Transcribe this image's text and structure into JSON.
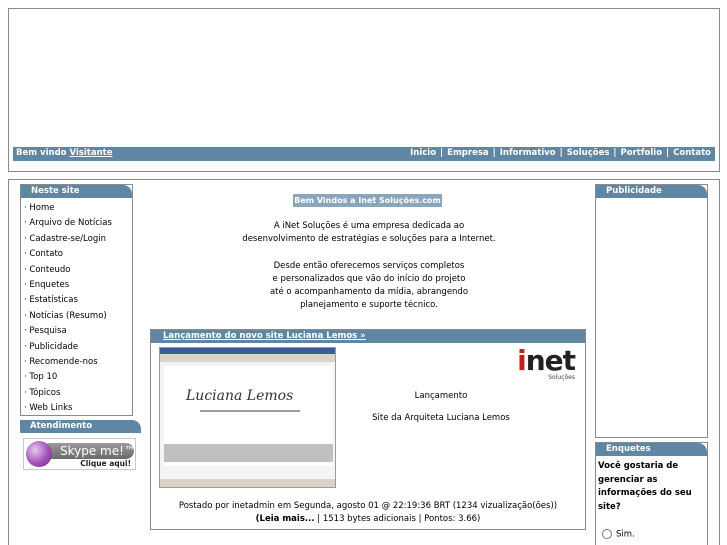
{
  "topbar": {
    "welcome_prefix": "Bem vindo",
    "welcome_user": "Visitante",
    "nav": [
      "Inicio",
      "Empresa",
      "Informativo",
      "Soluções",
      "Portfolio",
      "Contato"
    ]
  },
  "left_menu": {
    "title": "Neste site",
    "items": [
      "· Home",
      "· Arquivo de Notícias",
      "· Cadastre-se/Login",
      "· Contato",
      "· Conteudo",
      "· Enquetes",
      "· Estatísticas",
      "· Notícias (Resumo)",
      "· Pesquisa",
      "· Publicidade",
      "· Recomende-nos",
      "· Top 10",
      "· Tópicos",
      "· Web Links"
    ]
  },
  "atendimento": {
    "title": "Atendimento",
    "skype_label": "Skype me!™",
    "skype_cta": "Clique aqui!"
  },
  "center": {
    "welcome_title": "Bem Vindos a Inet Soluções.com",
    "intro_lines_1": [
      "A iNet Soluções é uma  empresa dedicada ao",
      "desenvolvimento de estratégias e soluções para a Internet."
    ],
    "intro_lines_2": [
      "Desde então oferecemos serviços completos",
      "e personalizados que vão do início do projeto",
      "até o acompanhamento da mídia, abrangendo",
      "planejamento e suporte técnico."
    ]
  },
  "news": {
    "title": "Lançamento do novo site Luciana Lemos »",
    "line1": "Lançamento",
    "line2": "Site da Arquiteta Luciana Lemos",
    "logo_word": "net",
    "logo_i": "i",
    "logo_sub": "Soluções",
    "posted": "Postado por inetadmin em Segunda, agosto 01 @ 22:19:36 BRT (1234 vizualização(ões))",
    "more": "(Leia mais...",
    "stats": " | 1513 bytes adicionais | Pontos: 3.66)"
  },
  "publicidade": {
    "title": "Publicidade"
  },
  "enquetes": {
    "title": "Enquetes",
    "question": "Você gostaria de gerenciar as informações do seu site?",
    "option1": "Sim."
  },
  "colors": {
    "bar": "#5f86a2",
    "title_bg": "#8aa6bd",
    "border": "#8a8a8a"
  }
}
